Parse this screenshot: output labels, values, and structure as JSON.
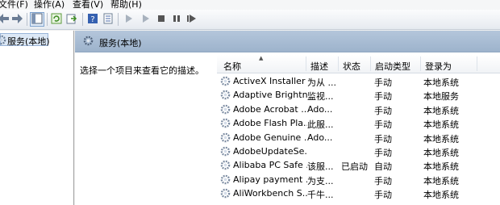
{
  "menu": [
    "文件(F)",
    "操作(A)",
    "查看(V)",
    "帮助(H)"
  ],
  "toolbar": {
    "icons": [
      "arrow-left-icon",
      "arrow-right-icon",
      "console-tree-icon",
      "refresh-icon",
      "export-icon",
      "help-icon",
      "properties-icon",
      "play-icon",
      "play-selected-icon",
      "stop-icon",
      "pause-icon",
      "restart-icon"
    ]
  },
  "tree": {
    "root_label": "服务(本地)"
  },
  "panel": {
    "title": "服务(本地)",
    "description": "选择一个项目来查看它的描述。"
  },
  "table": {
    "headers": {
      "name": "名称",
      "desc": "描述",
      "status": "状态",
      "type": "启动类型",
      "logon": "登录为"
    },
    "rows": [
      {
        "name": "ActiveX Installer ...",
        "desc": "为从 ...",
        "status": "",
        "type": "手动",
        "logon": "本地系统"
      },
      {
        "name": "Adaptive Brightn...",
        "desc": "监视...",
        "status": "",
        "type": "手动",
        "logon": "本地服务"
      },
      {
        "name": "Adobe Acrobat ...",
        "desc": "Ado...",
        "status": "",
        "type": "手动",
        "logon": "本地系统"
      },
      {
        "name": "Adobe Flash Pla...",
        "desc": "此服...",
        "status": "",
        "type": "手动",
        "logon": "本地系统"
      },
      {
        "name": "Adobe Genuine ...",
        "desc": "Ado...",
        "status": "",
        "type": "手动",
        "logon": "本地系统"
      },
      {
        "name": "AdobeUpdateSe...",
        "desc": "",
        "status": "",
        "type": "手动",
        "logon": "本地系统"
      },
      {
        "name": "Alibaba PC Safe ...",
        "desc": "该服...",
        "status": "已启动",
        "type": "自动",
        "logon": "本地系统"
      },
      {
        "name": "Alipay payment ...",
        "desc": "为支...",
        "status": "",
        "type": "手动",
        "logon": "本地系统"
      },
      {
        "name": "AliWorkbench S...",
        "desc": "千牛...",
        "status": "",
        "type": "手动",
        "logon": "本地系统"
      }
    ]
  }
}
